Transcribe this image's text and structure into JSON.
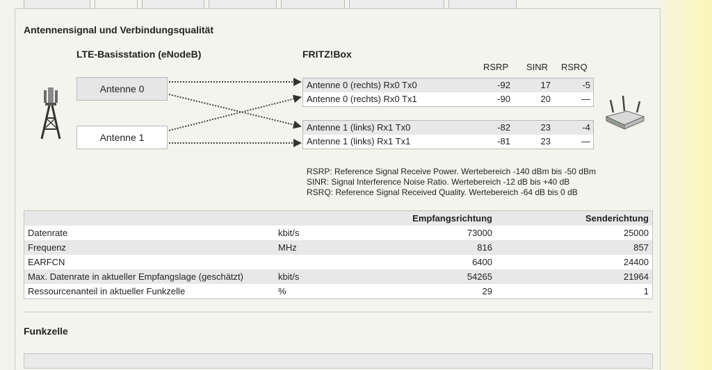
{
  "tabs": [
    "",
    "",
    "",
    "",
    "",
    "",
    ""
  ],
  "section_title": "Antennensignal und Verbindungsqualität",
  "lte_title": "LTE-Basisstation (eNodeB)",
  "fritz_title": "FRITZ!Box",
  "antennas": [
    "Antenne 0",
    "Antenne 1"
  ],
  "headers": {
    "rsrp": "RSRP",
    "sinr": "SINR",
    "rsrq": "RSRQ"
  },
  "signals": [
    {
      "label": "Antenne 0 (rechts) Rx0 Tx0",
      "rsrp": "-92",
      "sinr": "17",
      "rsrq": "-5"
    },
    {
      "label": "Antenne 0 (rechts) Rx0 Tx1",
      "rsrp": "-90",
      "sinr": "20",
      "rsrq": "—"
    },
    {
      "label": "Antenne 1 (links) Rx1 Tx0",
      "rsrp": "-82",
      "sinr": "23",
      "rsrq": "-4"
    },
    {
      "label": "Antenne 1 (links) Rx1 Tx1",
      "rsrp": "-81",
      "sinr": "23",
      "rsrq": "—"
    }
  ],
  "legend": [
    "RSRP: Reference Signal Receive Power. Wertebereich -140 dBm bis -50 dBm",
    "SINR: Signal Interference Noise Ratio. Wertebereich -12 dB bis +40 dB",
    "RSRQ: Reference Signal Received Quality. Wertebereich -64 dB bis 0 dB"
  ],
  "table": {
    "headers": [
      "",
      "",
      "Empfangsrichtung",
      "Senderichtung"
    ],
    "rows": [
      [
        "Datenrate",
        "kbit/s",
        "73000",
        "25000"
      ],
      [
        "Frequenz",
        "MHz",
        "816",
        "857"
      ],
      [
        "EARFCN",
        "",
        "6400",
        "24400"
      ],
      [
        "Max. Datenrate in aktueller Empfangslage (geschätzt)",
        "kbit/s",
        "54265",
        "21964"
      ],
      [
        "Ressourcenanteil in aktueller Funkzelle",
        "%",
        "29",
        "1"
      ]
    ]
  },
  "section2_title": "Funkzelle",
  "icons": {
    "tower": "cell-tower-icon",
    "router": "router-icon"
  }
}
